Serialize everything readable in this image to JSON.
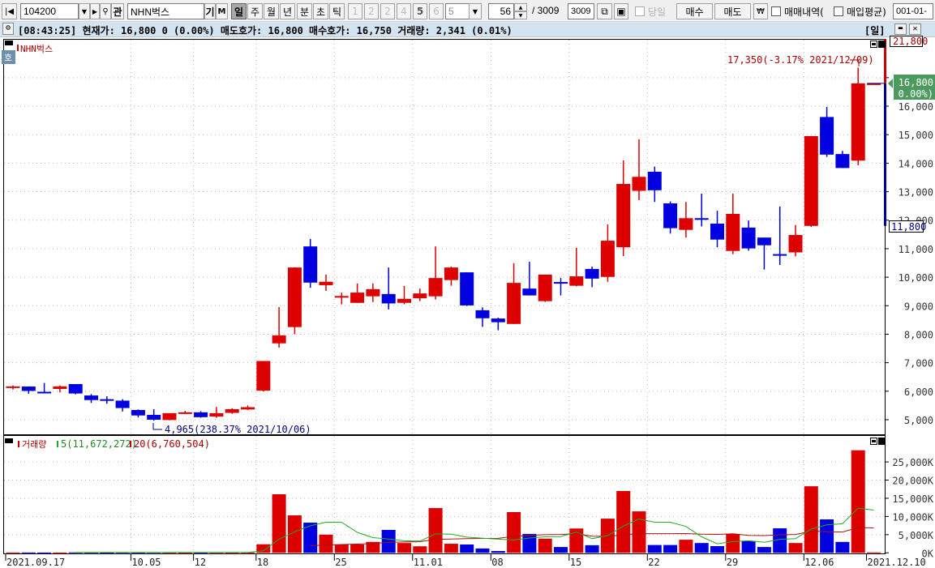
{
  "toolbar": {
    "first_label": "|◀",
    "code": "104200",
    "name": "NHN벅스",
    "kwan": "관",
    "gi": "기",
    "m": "M",
    "periods": [
      "일",
      "주",
      "월",
      "년",
      "분",
      "초",
      "틱"
    ],
    "numbers": [
      "1",
      "2",
      "2",
      "4",
      "5",
      "6"
    ],
    "number_select": "5",
    "count": "56",
    "slash_total": "/ 3009",
    "total_box": "3009",
    "today_label": "당일",
    "buy_label": "매수",
    "sell_label": "매도",
    "won_label": "₩",
    "trades_label": "매매내역(",
    "avg_label": "매입평균)",
    "date_input": "001-01-"
  },
  "info": {
    "text": "[08:43:25] 현재가: 16,800 0 (0.00%) 매도호가: 16,800 매수호가: 16,750 거래량: 2,341 (0.01%)",
    "period": "[일]"
  },
  "price_pane": {
    "side_tag": "호",
    "stock_label": "NHN벅스",
    "high_annotation": "17,350(-3.17% 2021/12/09)",
    "low_annotation": "4,965(238.37% 2021/10/06)",
    "range_high": "21,800",
    "range_low": "11,800",
    "current_price": "16,800",
    "current_change": "( 0.00%)",
    "y_ticks": [
      "5,000",
      "6,000",
      "7,000",
      "8,000",
      "9,000",
      "10,000",
      "11,000",
      "12,000",
      "13,000",
      "14,000",
      "15,000",
      "16,000",
      "17,000"
    ]
  },
  "volume_pane": {
    "legend_title": "거래량",
    "ma5_label": "5(11,672,272)",
    "ma20_label": "20(6,760,504)",
    "y_ticks": [
      "0K",
      "5,000K",
      "10,000K",
      "15,000K",
      "20,000K",
      "25,000K"
    ]
  },
  "x_axis": {
    "labels": [
      {
        "text": "2021.09.17",
        "i": 0
      },
      {
        "text": "10.05",
        "i": 8
      },
      {
        "text": "12",
        "i": 12
      },
      {
        "text": "18",
        "i": 16
      },
      {
        "text": "25",
        "i": 21
      },
      {
        "text": "11.01",
        "i": 26
      },
      {
        "text": "08",
        "i": 31
      },
      {
        "text": "15",
        "i": 36
      },
      {
        "text": "22",
        "i": 41
      },
      {
        "text": "29",
        "i": 46
      },
      {
        "text": "12.06",
        "i": 51
      },
      {
        "text": "2021.12.10",
        "i": 55
      }
    ]
  },
  "colors": {
    "up": "#dd0000",
    "down": "#0000e0",
    "ma5": "#22aa22",
    "ma20": "#aa1111",
    "tag": "#4c9a5e"
  },
  "chart_data": {
    "type": "candlestick",
    "title": "NHN벅스",
    "ylim": [
      4490,
      18330
    ],
    "ohlc": [
      [
        6120,
        6200,
        6060,
        6170
      ],
      [
        6165,
        6170,
        5910,
        6010
      ],
      [
        5980,
        6290,
        5980,
        5980
      ],
      [
        6080,
        6200,
        5960,
        6170
      ],
      [
        6250,
        6250,
        5890,
        5920
      ],
      [
        5850,
        5900,
        5590,
        5690
      ],
      [
        5720,
        5820,
        5560,
        5690
      ],
      [
        5670,
        5720,
        5290,
        5410
      ],
      [
        5340,
        5360,
        5080,
        5150
      ],
      [
        5170,
        5370,
        4965,
        5000
      ],
      [
        4990,
        5230,
        4980,
        5230
      ],
      [
        5220,
        5310,
        5200,
        5260
      ],
      [
        5260,
        5300,
        5070,
        5090
      ],
      [
        5110,
        5450,
        5070,
        5230
      ],
      [
        5240,
        5400,
        5210,
        5370
      ],
      [
        5360,
        5500,
        5340,
        5440
      ],
      [
        6020,
        7060,
        5990,
        7060
      ],
      [
        7680,
        8950,
        7530,
        7960
      ],
      [
        8250,
        10350,
        8000,
        10340
      ],
      [
        11080,
        11340,
        9630,
        9810
      ],
      [
        9720,
        10090,
        9520,
        9840
      ],
      [
        9310,
        9460,
        9050,
        9340
      ],
      [
        9100,
        9780,
        9100,
        9460
      ],
      [
        9330,
        9780,
        9130,
        9580
      ],
      [
        9410,
        10340,
        8870,
        9080
      ],
      [
        9100,
        9690,
        9050,
        9240
      ],
      [
        9260,
        9600,
        9160,
        9430
      ],
      [
        9330,
        11080,
        9220,
        9970
      ],
      [
        9900,
        10370,
        9700,
        10340
      ],
      [
        10170,
        10170,
        8990,
        9010
      ],
      [
        8840,
        8940,
        8260,
        8560
      ],
      [
        8550,
        8580,
        8140,
        8420
      ],
      [
        8360,
        10490,
        8360,
        9800
      ],
      [
        9600,
        10540,
        9360,
        9360
      ],
      [
        9160,
        10090,
        9130,
        10090
      ],
      [
        9830,
        9970,
        9360,
        9800
      ],
      [
        9700,
        11030,
        9680,
        10030
      ],
      [
        10290,
        10370,
        9650,
        9950
      ],
      [
        10010,
        11850,
        9840,
        11280
      ],
      [
        11050,
        14100,
        10740,
        13270
      ],
      [
        13030,
        14840,
        12700,
        13520
      ],
      [
        13700,
        13880,
        12640,
        13050
      ],
      [
        12590,
        12660,
        11530,
        11720
      ],
      [
        11660,
        12640,
        11390,
        12070
      ],
      [
        12070,
        12930,
        11780,
        12060
      ],
      [
        11880,
        12330,
        11050,
        11320
      ],
      [
        10920,
        12930,
        10810,
        12220
      ],
      [
        11740,
        11990,
        10930,
        11010
      ],
      [
        11390,
        11390,
        10270,
        11120
      ],
      [
        10810,
        12480,
        10430,
        10800
      ],
      [
        10870,
        11830,
        10730,
        11480
      ],
      [
        11800,
        14950,
        11760,
        14950
      ],
      [
        15620,
        15970,
        14220,
        14300
      ],
      [
        14320,
        14430,
        13830,
        13830
      ],
      [
        14090,
        17350,
        13930,
        16800
      ],
      [
        16800,
        16800,
        16800,
        16800
      ]
    ],
    "volume_k": [
      120,
      110,
      90,
      100,
      140,
      120,
      90,
      130,
      110,
      150,
      120,
      100,
      110,
      130,
      110,
      120,
      2360,
      16100,
      10300,
      8300,
      5000,
      2300,
      2300,
      3000,
      6300,
      2700,
      1800,
      12300,
      2500,
      2300,
      1200,
      500,
      11200,
      5200,
      3900,
      1600,
      6700,
      2100,
      9400,
      17000,
      11400,
      2150,
      2150,
      3600,
      2700,
      1850,
      5200,
      3250,
      1600,
      6750,
      2700,
      18300,
      9200,
      3000,
      28200,
      140
    ],
    "volume_ylim": [
      0,
      30000
    ]
  }
}
